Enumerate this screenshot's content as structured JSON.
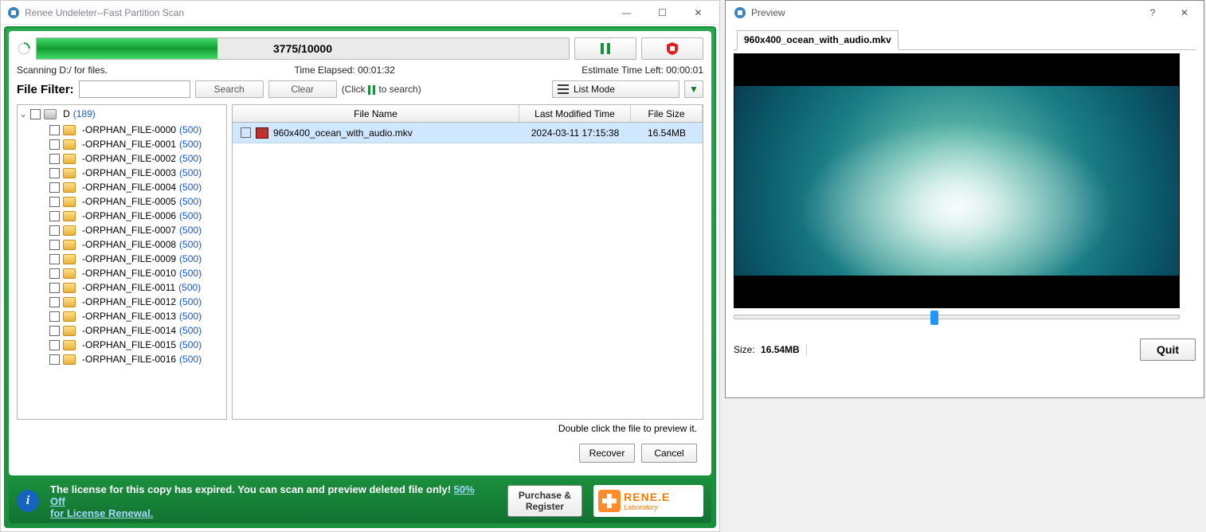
{
  "main": {
    "title": "Renee Undeleter--Fast Partition Scan",
    "progress": {
      "label": "3775/10000",
      "fill_percent": 34
    },
    "controls": {
      "pause_icon": "pause",
      "stop_icon": "stop"
    },
    "status": {
      "scanning": "Scanning D:/ for files.",
      "elapsed": "Time Elapsed: 00:01:32",
      "estimate": "Estimate Time Left: 00:00:01"
    },
    "filter": {
      "label": "File  Filter:",
      "search": "Search",
      "clear": "Clear",
      "hint_pre": "(Click ",
      "hint_post": " to search)",
      "mode": "List Mode"
    },
    "tree": {
      "root_label": "D",
      "root_count": "(189)",
      "items": [
        {
          "name": "-ORPHAN_FILE-0000",
          "count": "(500)"
        },
        {
          "name": "-ORPHAN_FILE-0001",
          "count": "(500)"
        },
        {
          "name": "-ORPHAN_FILE-0002",
          "count": "(500)"
        },
        {
          "name": "-ORPHAN_FILE-0003",
          "count": "(500)"
        },
        {
          "name": "-ORPHAN_FILE-0004",
          "count": "(500)"
        },
        {
          "name": "-ORPHAN_FILE-0005",
          "count": "(500)"
        },
        {
          "name": "-ORPHAN_FILE-0006",
          "count": "(500)"
        },
        {
          "name": "-ORPHAN_FILE-0007",
          "count": "(500)"
        },
        {
          "name": "-ORPHAN_FILE-0008",
          "count": "(500)"
        },
        {
          "name": "-ORPHAN_FILE-0009",
          "count": "(500)"
        },
        {
          "name": "-ORPHAN_FILE-0010",
          "count": "(500)"
        },
        {
          "name": "-ORPHAN_FILE-0011",
          "count": "(500)"
        },
        {
          "name": "-ORPHAN_FILE-0012",
          "count": "(500)"
        },
        {
          "name": "-ORPHAN_FILE-0013",
          "count": "(500)"
        },
        {
          "name": "-ORPHAN_FILE-0014",
          "count": "(500)"
        },
        {
          "name": "-ORPHAN_FILE-0015",
          "count": "(500)"
        },
        {
          "name": "-ORPHAN_FILE-0016",
          "count": "(500)"
        }
      ]
    },
    "list": {
      "headers": {
        "name": "File Name",
        "date": "Last Modified Time",
        "size": "File Size"
      },
      "rows": [
        {
          "name": "960x400_ocean_with_audio.mkv",
          "date": "2024-03-11 17:15:38",
          "size": "16.54MB"
        }
      ],
      "hint": "Double click the file to preview it."
    },
    "actions": {
      "recover": "Recover",
      "cancel": "Cancel"
    },
    "license": {
      "msg1": "The license for this copy has expired. You can scan and preview deleted file only! ",
      "link1": "50% Off",
      "msg2": "for License Renewal.",
      "purchase_l1": "Purchase &",
      "purchase_l2": "Register",
      "logo_l1": "RENE.E",
      "logo_l2": "Laboratory"
    }
  },
  "preview": {
    "title": "Preview",
    "tab": "960x400_ocean_with_audio.mkv",
    "size_label": "Size:",
    "size_value": "16.54MB",
    "quit": "Quit"
  }
}
